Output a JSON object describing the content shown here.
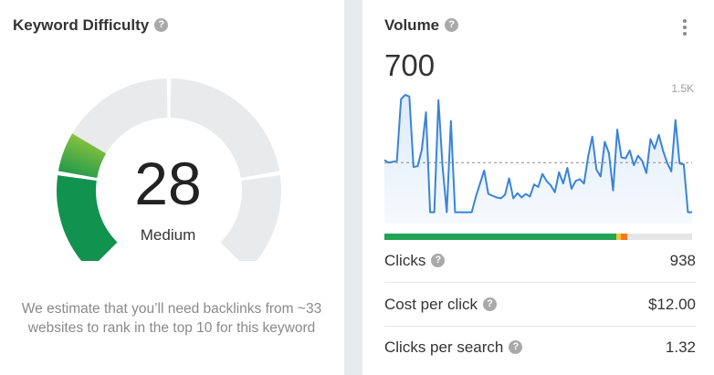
{
  "keyword_difficulty": {
    "title": "Keyword Difficulty",
    "help_icon": "question-circle-icon",
    "score": "28",
    "score_value": 28,
    "level": "Medium",
    "description": "We estimate that you’ll need backlinks from ~33 websites to rank in the top 10 for this keyword",
    "colors": {
      "track": "#e9eaeb",
      "fill_dark": "#11924f",
      "fill_light": "#8cc43c"
    }
  },
  "volume": {
    "title": "Volume",
    "help_icon": "question-circle-icon",
    "menu_icon": "more-vertical-icon",
    "value": "700",
    "chart_data": {
      "type": "area",
      "y_max_label": "1.5K",
      "ylim": [
        0,
        1500
      ],
      "reference_value": 700,
      "values": [
        730,
        700,
        710,
        720,
        1430,
        1480,
        1460,
        650,
        660,
        850,
        1280,
        130,
        130,
        1420,
        650,
        130,
        1180,
        130,
        130,
        130,
        130,
        130,
        310,
        460,
        610,
        340,
        320,
        300,
        290,
        330,
        520,
        290,
        350,
        300,
        340,
        310,
        450,
        420,
        570,
        490,
        440,
        360,
        590,
        460,
        640,
        400,
        490,
        510,
        460,
        770,
        1000,
        620,
        540,
        940,
        810,
        380,
        1080,
        760,
        750,
        840,
        670,
        780,
        720,
        580,
        970,
        860,
        1020,
        840,
        700,
        600,
        1190,
        690,
        680,
        130,
        130
      ],
      "line_color": "#3b84d6",
      "fill_color": "#dbeaf9",
      "grid": false
    },
    "distribution_bar": [
      {
        "name": "organic",
        "color": "#23a455",
        "share": 0.755
      },
      {
        "name": "paid-yellow",
        "color": "#f5c242",
        "share": 0.015
      },
      {
        "name": "paid-orange",
        "color": "#f07a1f",
        "share": 0.02
      },
      {
        "name": "no-clicks",
        "color": "#e6e6e6",
        "share": 0.21
      }
    ]
  },
  "metrics": [
    {
      "label": "Clicks",
      "value": "938"
    },
    {
      "label": "Cost per click",
      "value": "$12.00"
    },
    {
      "label": "Clicks per search",
      "value": "1.32"
    }
  ]
}
